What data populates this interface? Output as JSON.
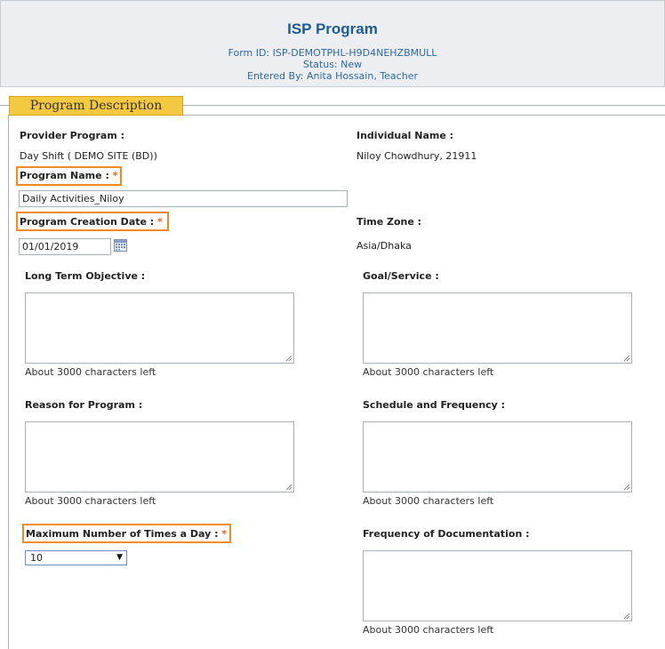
{
  "header": {
    "title": "ISP Program",
    "form_id": "Form ID: ISP-DEMOTPHL-H9D4NEHZBMULL",
    "status": "Status: New",
    "entered_by": "Entered By: Anita Hossain, Teacher"
  },
  "section": {
    "tab_label": "Program Description"
  },
  "fields": {
    "provider_program": {
      "label": "Provider Program :",
      "value": "Day Shift ( DEMO SITE (BD))"
    },
    "individual_name": {
      "label": "Individual Name :",
      "value": "Niloy Chowdhury, 21911"
    },
    "program_name": {
      "label": "Program Name :",
      "required_mark": "*",
      "value": "Daily Activities_Niloy"
    },
    "program_creation_date": {
      "label": "Program Creation Date :",
      "required_mark": "*",
      "value": "01/01/2019"
    },
    "time_zone": {
      "label": "Time Zone :",
      "value": "Asia/Dhaka"
    },
    "long_term_objective": {
      "label": "Long Term Objective :",
      "note": "About 3000 characters left"
    },
    "goal_service": {
      "label": "Goal/Service :",
      "note": "About 3000 characters left"
    },
    "reason_for_program": {
      "label": "Reason for Program :",
      "note": "About 3000 characters left"
    },
    "schedule_frequency": {
      "label": "Schedule and Frequency :",
      "note": "About 3000 characters left"
    },
    "max_times_day": {
      "label": "Maximum Number of Times a Day :",
      "required_mark": "*",
      "value": "10"
    },
    "frequency_documentation": {
      "label": "Frequency of Documentation :",
      "note": "About 3000 characters left"
    }
  },
  "colors": {
    "title_blue": "#1e5b93",
    "highlight_orange": "#f08a24",
    "tab_yellow": "#f5c842"
  },
  "icons": [
    "calendar-icon",
    "dropdown-arrow-icon",
    "resize-grip-icon"
  ]
}
